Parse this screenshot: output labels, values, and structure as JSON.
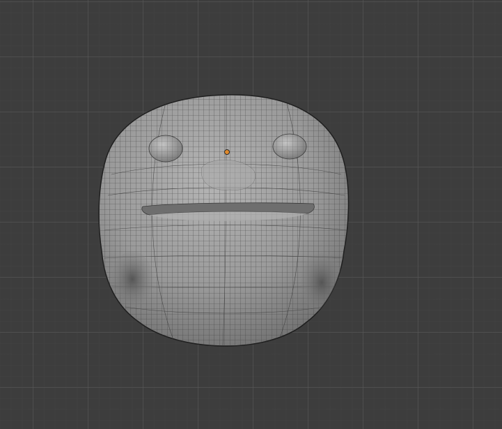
{
  "viewport": {
    "background_color": "#3d3d3d",
    "grid_major_color": "#5a5a5a",
    "grid_minor_color": "#464646"
  },
  "mesh": {
    "object": "head-sculpt-mesh",
    "surface_color": "#9a9a9a",
    "wire_color": "#3a3a3a",
    "outline_color": "#1e1e1e"
  },
  "origin": {
    "color": "#e08a2c",
    "icon": "object-origin-icon"
  }
}
